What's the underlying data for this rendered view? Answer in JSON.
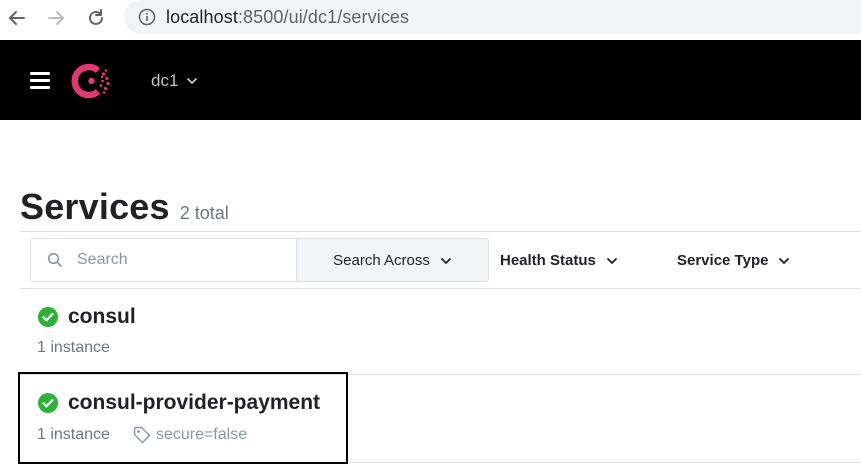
{
  "browser": {
    "url_host": "localhost",
    "url_path": ":8500/ui/dc1/services",
    "icons": [
      "back-arrow-icon",
      "forward-arrow-icon",
      "reload-icon",
      "info-icon"
    ]
  },
  "header": {
    "datacenter": "dc1",
    "brand_color": "#e03875",
    "background": "#000000"
  },
  "page": {
    "title": "Services",
    "total": "2 total"
  },
  "search": {
    "placeholder": "Search",
    "search_across": "Search Across",
    "health_status": "Health Status",
    "service_type": "Service Type"
  },
  "services": [
    {
      "name": "consul",
      "instances": "1 instance",
      "tags": [],
      "status": "passing"
    },
    {
      "name": "consul-provider-payment",
      "instances": "1 instance",
      "tags": [
        "secure=false"
      ],
      "status": "passing"
    }
  ],
  "colors": {
    "passing": "#2eb039",
    "muted_text": "#6f7682"
  }
}
